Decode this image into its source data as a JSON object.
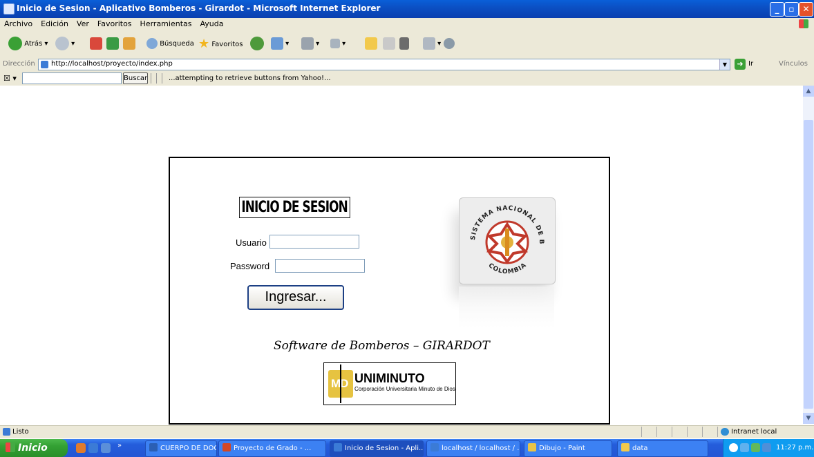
{
  "window": {
    "title": "Inicio de Sesion - Aplicativo Bomberos - Girardot - Microsoft Internet Explorer",
    "minimize": "_",
    "maximize": "▫",
    "close": "✕"
  },
  "menu": [
    "Archivo",
    "Edición",
    "Ver",
    "Favoritos",
    "Herramientas",
    "Ayuda"
  ],
  "toolbar": {
    "back_label": "Atrás",
    "search_label": "Búsqueda",
    "favorites_label": "Favoritos"
  },
  "address": {
    "label": "Dirección",
    "url": "http://localhost/proyecto/index.php",
    "go_label": "Ir",
    "links_label": "Vínculos"
  },
  "yahoo": {
    "search_button": "Buscar",
    "message": "...attempting to retrieve buttons from Yahoo!..."
  },
  "login": {
    "heading": "INICIO DE SESION",
    "user_label": "Usuario",
    "user_value": "",
    "password_label": "Password",
    "password_value": "",
    "submit_label": "Ingresar...",
    "footer": "Software de Bomberos – GIRARDOT"
  },
  "logo": {
    "top_text": "SISTEMA NACIONAL DE BOMBEROS",
    "bottom_text": "COLOMBIA"
  },
  "partner_logo": {
    "name": "UNIMINUTO",
    "subtitle": "Corporación Universitaria Minuto de Dios",
    "initials": "MD"
  },
  "status": {
    "text": "Listo",
    "zone": "Intranet local"
  },
  "taskbar": {
    "start_label": "Inicio",
    "tasks": [
      {
        "label": "CUERPO DE DOCUME...",
        "icon_color": "#2b5fb4",
        "active": false
      },
      {
        "label": "Proyecto de Grado - ...",
        "icon_color": "#d24726",
        "active": false
      },
      {
        "label": "Inicio de Sesion - Apli...",
        "icon_color": "#3b7bd6",
        "active": true
      },
      {
        "label": "localhost / localhost / ...",
        "icon_color": "#3b7bd6",
        "active": false
      },
      {
        "label": "Dibujo - Paint",
        "icon_color": "#e8c347",
        "active": false
      },
      {
        "label": "data",
        "icon_color": "#f2c94c",
        "active": false
      }
    ],
    "clock": "11:27 p.m."
  }
}
